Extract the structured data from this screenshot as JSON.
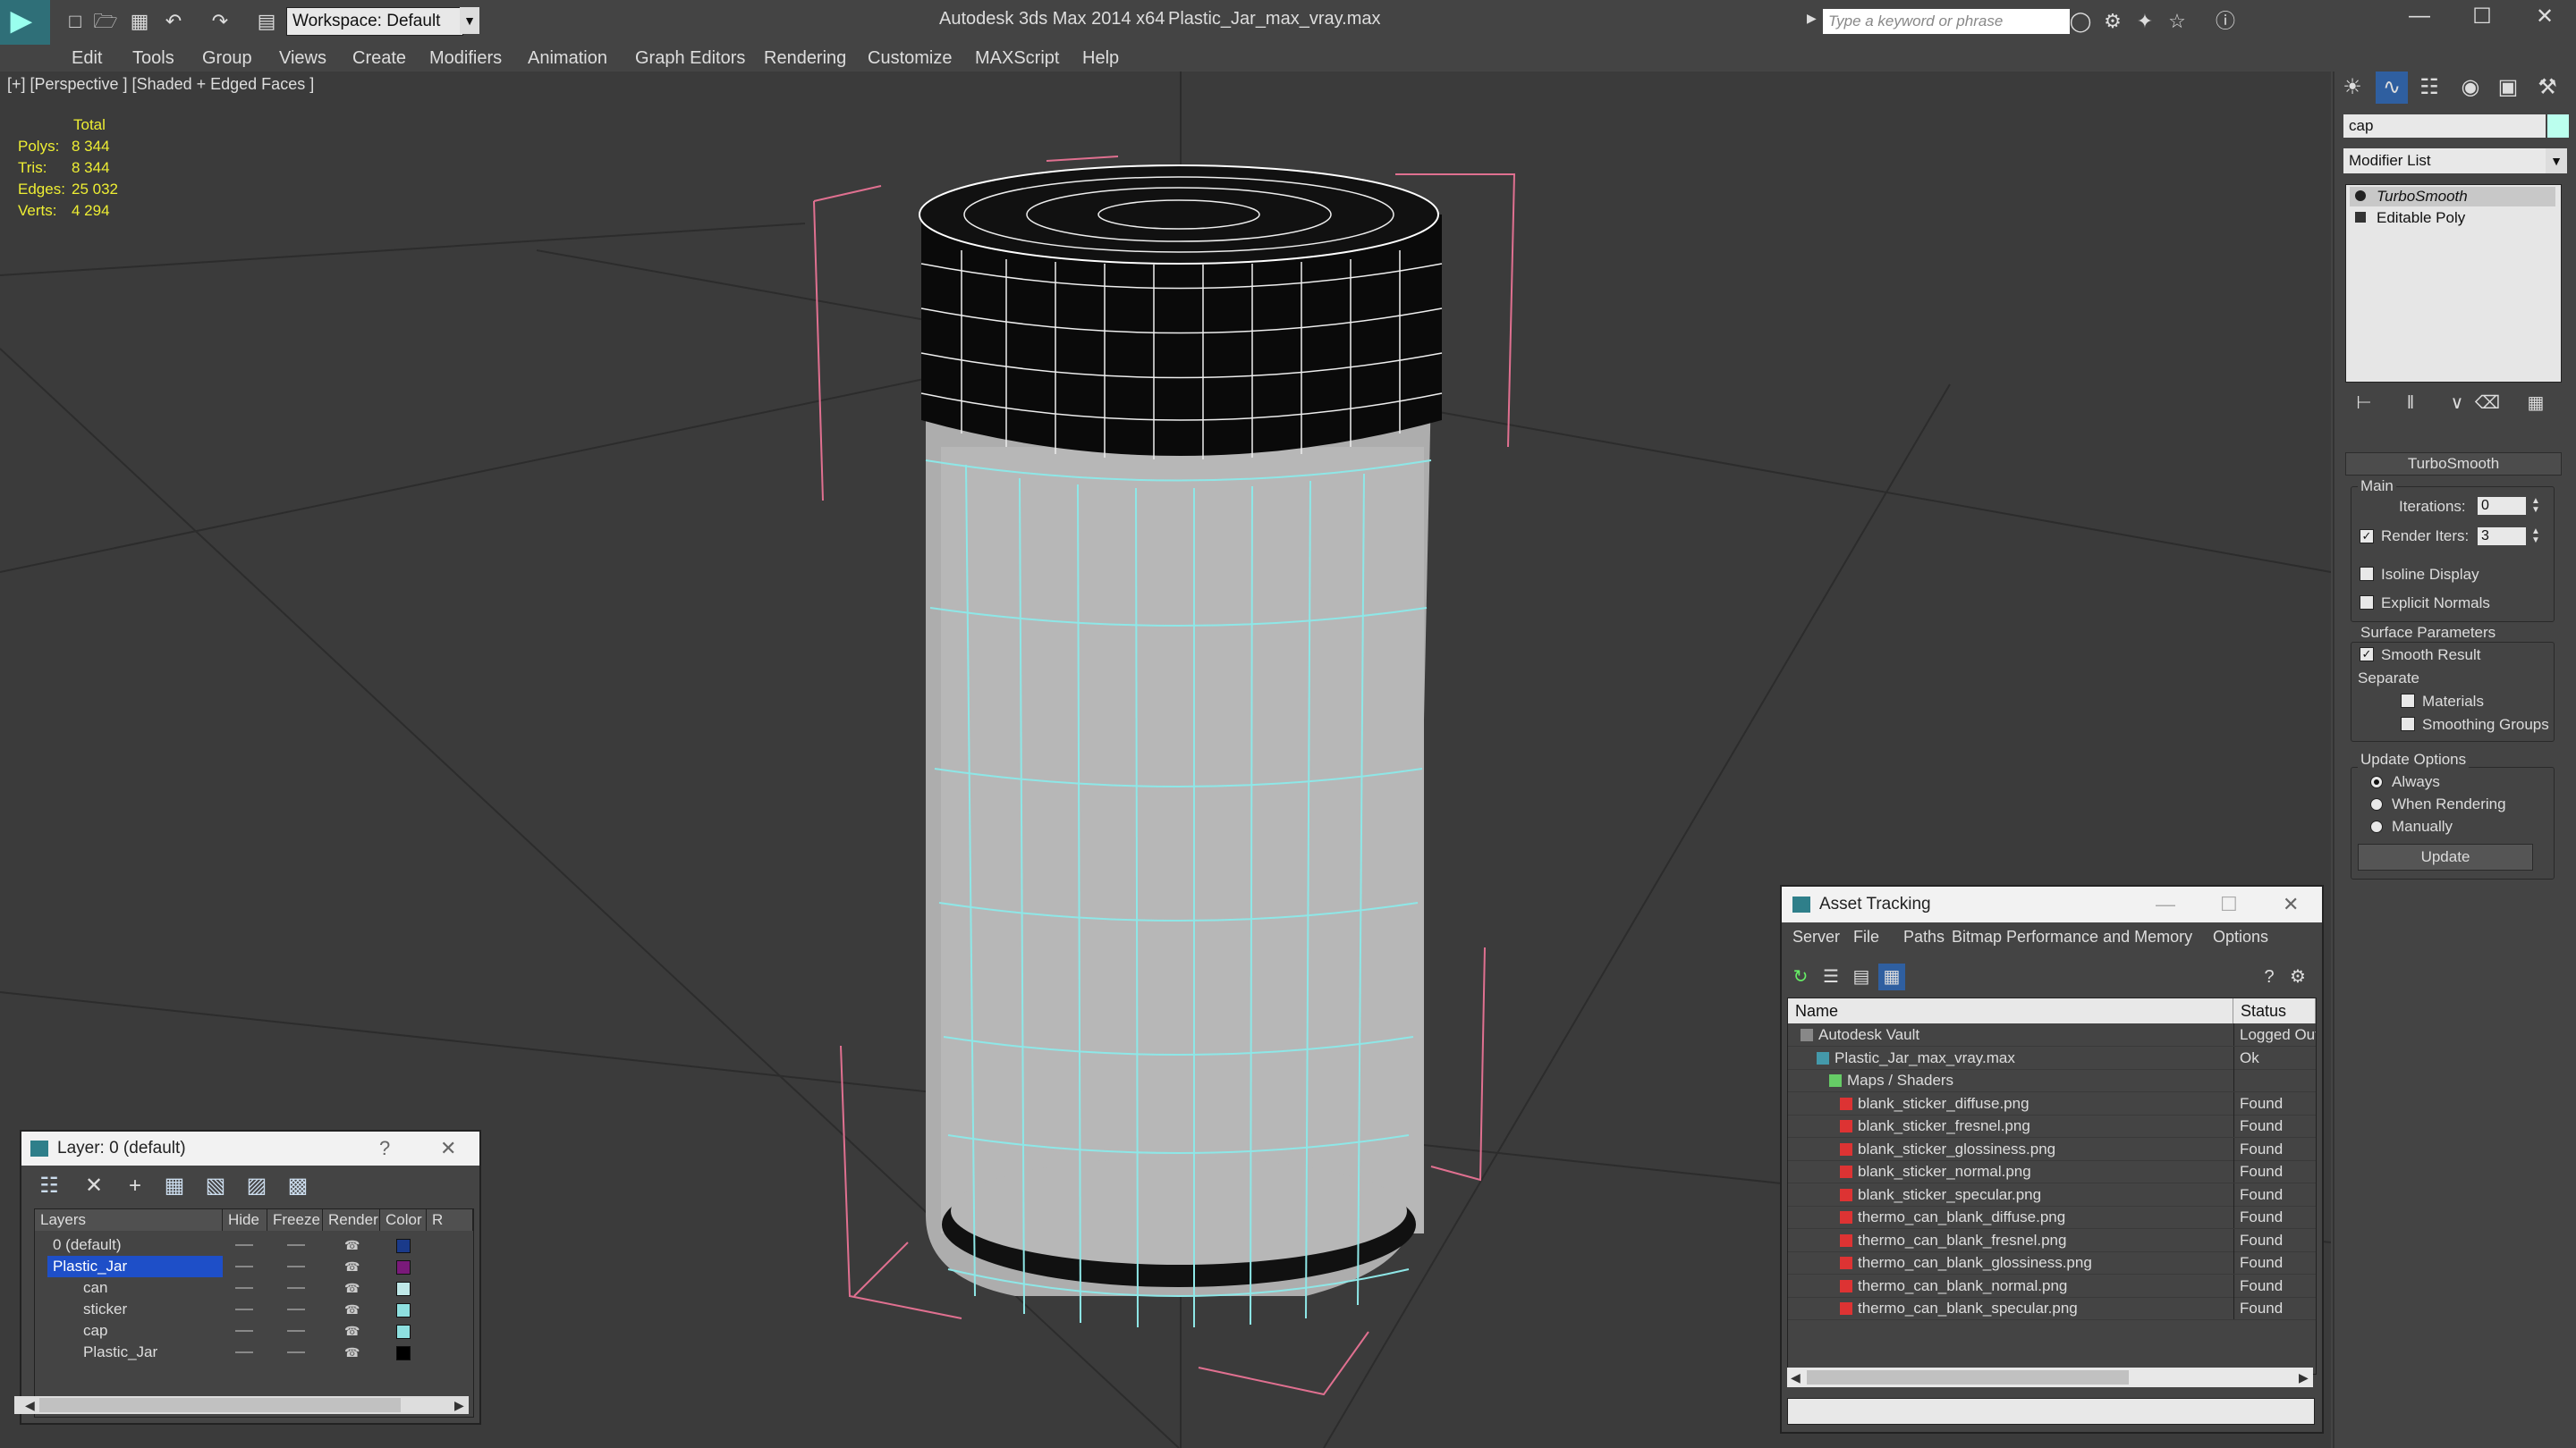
{
  "titlebar": {
    "workspace": "Workspace: Default",
    "app_title": "Autodesk 3ds Max  2014 x64",
    "doc_title": "Plastic_Jar_max_vray.max",
    "search_placeholder": "Type a keyword or phrase"
  },
  "menu": [
    "Edit",
    "Tools",
    "Group",
    "Views",
    "Create",
    "Modifiers",
    "Animation",
    "Graph Editors",
    "Rendering",
    "Customize",
    "MAXScript",
    "Help"
  ],
  "viewport": {
    "label": "[+] [Perspective ] [Shaded + Edged Faces ]",
    "stats": {
      "header": "Total",
      "rows": [
        {
          "k": "Polys:",
          "v": "8 344"
        },
        {
          "k": "Tris:",
          "v": "8 344"
        },
        {
          "k": "Edges:",
          "v": "25 032"
        },
        {
          "k": "Verts:",
          "v": "4 294"
        }
      ]
    }
  },
  "command_panel": {
    "object_name": "cap",
    "modifier_list": "Modifier List",
    "stack": [
      "TurboSmooth",
      "Editable Poly"
    ],
    "rollout": "TurboSmooth",
    "main_label": "Main",
    "iterations_label": "Iterations:",
    "iterations_value": "0",
    "render_iters_label": "Render Iters:",
    "render_iters_value": "3",
    "isoline": "Isoline Display",
    "explicit": "Explicit Normals",
    "surface_params": "Surface Parameters",
    "smooth_result": "Smooth Result",
    "separate": "Separate",
    "materials": "Materials",
    "smoothing_groups": "Smoothing Groups",
    "update_options": "Update Options",
    "always": "Always",
    "when_rendering": "When Rendering",
    "manually": "Manually",
    "update_button": "Update"
  },
  "layer_dialog": {
    "title": "Layer: 0 (default)",
    "help": "?",
    "columns": [
      "Layers",
      "Hide",
      "Freeze",
      "Render",
      "Color",
      "R"
    ],
    "rows": [
      {
        "name": "0 (default)",
        "color": "#1a3a8a",
        "indent": 0
      },
      {
        "name": "Plastic_Jar",
        "color": "#7a1a7a",
        "indent": 0
      },
      {
        "name": "can",
        "color": "#bfe8e8",
        "indent": 1
      },
      {
        "name": "sticker",
        "color": "#8ee0e0",
        "indent": 1
      },
      {
        "name": "cap",
        "color": "#8ee0e0",
        "indent": 1
      },
      {
        "name": "Plastic_Jar",
        "color": "#000000",
        "indent": 1
      }
    ]
  },
  "asset_dialog": {
    "title": "Asset Tracking",
    "menu": [
      "Server",
      "File",
      "Paths",
      "Bitmap Performance and Memory",
      "Options"
    ],
    "columns": [
      "Name",
      "Status"
    ],
    "rows": [
      {
        "name": "Autodesk Vault",
        "status": "Logged Out",
        "level": 0
      },
      {
        "name": "Plastic_Jar_max_vray.max",
        "status": "Ok",
        "level": 1
      },
      {
        "name": "Maps / Shaders",
        "status": "",
        "level": 2
      },
      {
        "name": "blank_sticker_diffuse.png",
        "status": "Found",
        "level": 3
      },
      {
        "name": "blank_sticker_fresnel.png",
        "status": "Found",
        "level": 3
      },
      {
        "name": "blank_sticker_glossiness.png",
        "status": "Found",
        "level": 3
      },
      {
        "name": "blank_sticker_normal.png",
        "status": "Found",
        "level": 3
      },
      {
        "name": "blank_sticker_specular.png",
        "status": "Found",
        "level": 3
      },
      {
        "name": "thermo_can_blank_diffuse.png",
        "status": "Found",
        "level": 3
      },
      {
        "name": "thermo_can_blank_fresnel.png",
        "status": "Found",
        "level": 3
      },
      {
        "name": "thermo_can_blank_glossiness.png",
        "status": "Found",
        "level": 3
      },
      {
        "name": "thermo_can_blank_normal.png",
        "status": "Found",
        "level": 3
      },
      {
        "name": "thermo_can_blank_specular.png",
        "status": "Found",
        "level": 3
      }
    ]
  }
}
